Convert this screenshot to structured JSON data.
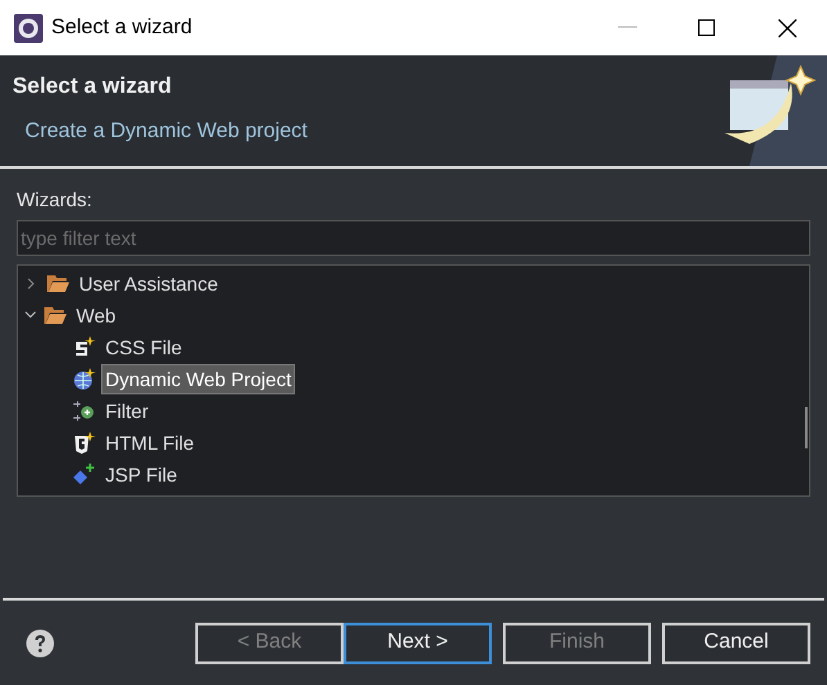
{
  "window": {
    "title": "Select a wizard"
  },
  "header": {
    "title": "Select a wizard",
    "description": "Create a Dynamic Web project"
  },
  "wizards": {
    "label": "Wizards:",
    "filter": {
      "placeholder": "type filter text"
    },
    "tree": [
      {
        "label": "User Assistance",
        "kind": "folder",
        "expanded": false,
        "selected": false
      },
      {
        "label": "Web",
        "kind": "folder",
        "expanded": true,
        "selected": false,
        "children": [
          {
            "label": "CSS File",
            "kind": "css",
            "selected": false
          },
          {
            "label": "Dynamic Web Project",
            "kind": "globe",
            "selected": true
          },
          {
            "label": "Filter",
            "kind": "filter",
            "selected": false
          },
          {
            "label": "HTML File",
            "kind": "html",
            "selected": false
          },
          {
            "label": "JSP File",
            "kind": "jsp",
            "selected": false
          }
        ]
      }
    ]
  },
  "buttons": [
    {
      "label": "< Back",
      "disabled": true,
      "default": false
    },
    {
      "label": "Next >",
      "disabled": false,
      "default": true
    },
    {
      "label": "Finish",
      "disabled": true,
      "default": false
    },
    {
      "label": "Cancel",
      "disabled": false,
      "default": false
    }
  ]
}
